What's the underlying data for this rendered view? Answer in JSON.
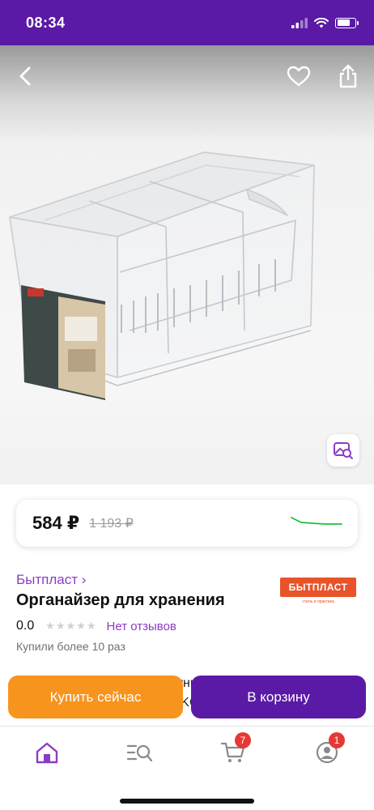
{
  "status_bar": {
    "time": "08:34",
    "battery_level": 0.75
  },
  "product": {
    "price": "584 ₽",
    "old_price": "1 193 ₽",
    "brand": "Бытпласт ›",
    "brand_logo_text": "БЫТПЛАСТ",
    "brand_logo_tagline": "стиль и практика",
    "title": "Органайзер для хранения",
    "rating": "0.0",
    "stars": "★★★★★",
    "reviews": "Нет отзывов",
    "bought": "Купили более 10 раз",
    "description": "Органайзер для хранения универсальный 6 литров. Контейнер универсальный KOLLY 6л"
  },
  "actions": {
    "buy_now": "Купить сейчас",
    "add_to_cart": "В корзину"
  },
  "tabbar": {
    "cart_badge": "7",
    "profile_badge": "1"
  },
  "colors": {
    "brand_purple": "#5a1aa6",
    "link_purple": "#8b3cc6",
    "orange": "#f7941d",
    "trend_green": "#1fbf3a",
    "badge_red": "#e53935"
  },
  "icons": [
    "back-icon",
    "heart-icon",
    "share-icon",
    "image-search-icon",
    "home-icon",
    "catalog-search-icon",
    "cart-icon",
    "profile-icon"
  ]
}
